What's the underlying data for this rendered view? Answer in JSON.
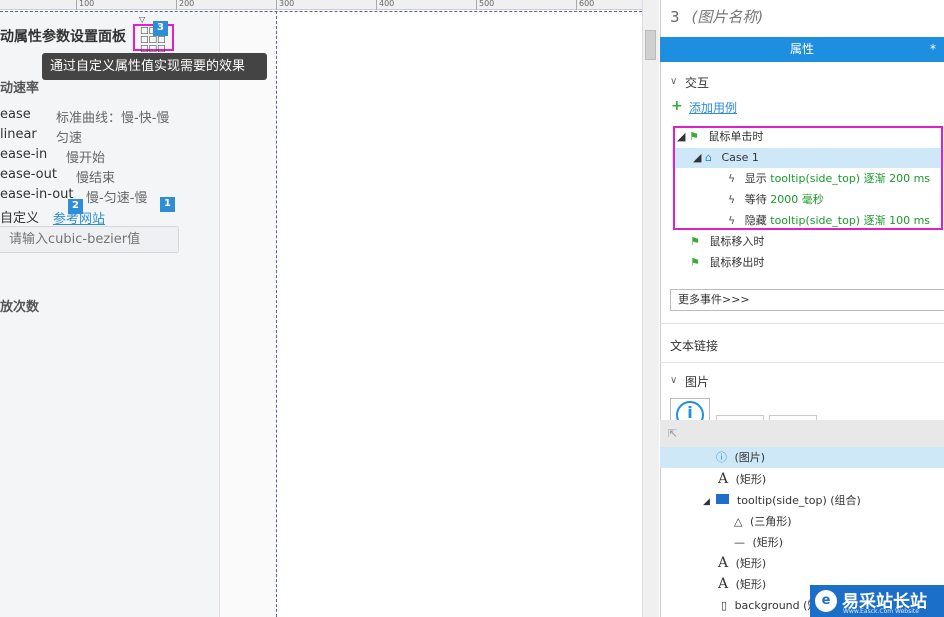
{
  "ruler": {
    "ticks": [
      "100",
      "200",
      "300",
      "400",
      "500",
      "600"
    ]
  },
  "widget": {
    "title": "动属性参数设置面板",
    "speed_heading": "动速率",
    "rows": [
      {
        "name": "ease",
        "desc": "标准曲线：慢-快-慢"
      },
      {
        "name": "linear",
        "desc": "匀速"
      },
      {
        "name": "ease-in",
        "desc": "慢开始"
      },
      {
        "name": "ease-out",
        "desc": "慢结束"
      },
      {
        "name": "ease-in-out",
        "desc": "慢-匀速-慢"
      }
    ],
    "custom_label": "自定义",
    "reference_link": "参考网站",
    "cubic_placeholder": "请输入cubic-bezier值",
    "play_count_heading": "放次数",
    "tooltip": "通过自定义属性值实现需要的效果",
    "badge_1": "1",
    "badge_2": "2",
    "badge_3": "3"
  },
  "panel": {
    "number": "3",
    "name": "(图片名称)",
    "tab": "属性",
    "tab_star": "*",
    "interaction_heading": "交互",
    "add_case": "添加用例",
    "events": {
      "click": "鼠标单击时",
      "case": "Case 1",
      "actions": [
        {
          "verb": "显示",
          "detail": "tooltip(side_top) 逐渐 200 ms"
        },
        {
          "verb": "等待",
          "detail": "2000 毫秒"
        },
        {
          "verb": "隐藏",
          "detail": "tooltip(side_top) 逐渐 100 ms"
        }
      ],
      "mouse_enter": "鼠标移入时",
      "mouse_leave": "鼠标移出时"
    },
    "more_events": "更多事件>>>",
    "text_link": "文本链接",
    "image_heading": "图片"
  },
  "outline": {
    "rows": [
      {
        "icon": "ⓘ",
        "label": "(图片)"
      },
      {
        "icon": "A",
        "label": "(矩形)"
      },
      {
        "icon": "folder",
        "label": "tooltip(side_top) (组合)"
      },
      {
        "icon": "△",
        "label": "(三角形)"
      },
      {
        "icon": "—",
        "label": "(矩形)"
      },
      {
        "icon": "A",
        "label": "(矩形)"
      },
      {
        "icon": "A",
        "label": "(矩形)"
      },
      {
        "icon": "▯",
        "label": "background (矩"
      }
    ]
  },
  "logo": {
    "text": "易采站长站",
    "sub": "Www.Easck.Com Website"
  },
  "colors": {
    "accent": "#1e8ee0",
    "highlight": "#e020c8",
    "green": "#1a9a2a"
  }
}
